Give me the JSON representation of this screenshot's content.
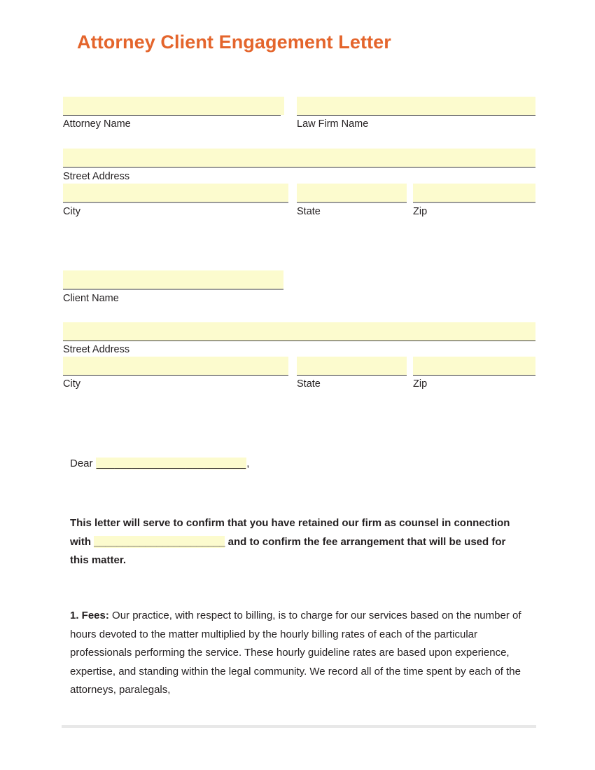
{
  "document": {
    "title": "Attorney Client Engagement Letter",
    "title_color": "#e4652c",
    "highlight_color": "#fcfbce",
    "page_background": "#ffffff",
    "text_color": "#231f20"
  },
  "attorney_block": {
    "name_field": {
      "caption": "Attorney Name",
      "value": ""
    },
    "firm_field": {
      "caption": "Law Firm Name",
      "value": ""
    },
    "street_field": {
      "caption": "Street Address",
      "value": ""
    },
    "city_field": {
      "caption": "City",
      "value": ""
    },
    "state_field": {
      "caption": "State",
      "value": ""
    },
    "zip_field": {
      "caption": "Zip",
      "value": ""
    }
  },
  "client_block": {
    "name_field": {
      "caption": "Client Name",
      "value": ""
    },
    "street_field": {
      "caption": "Street Address",
      "value": ""
    },
    "city_field": {
      "caption": "City",
      "value": ""
    },
    "state_field": {
      "caption": "State",
      "value": ""
    },
    "zip_field": {
      "caption": "Zip",
      "value": ""
    }
  },
  "salutation": {
    "prefix": "Dear ",
    "blank": "_________________________",
    "suffix": ","
  },
  "lead_paragraph": {
    "part1": "This letter will serve to confirm that you have retained our firm as counsel in connection with ",
    "blank": "_______________________",
    "part2": " and to confirm the fee arrangement that will be used for this matter."
  },
  "fees_section": {
    "label": "1. Fees:",
    "body": "  Our practice, with respect to billing, is to charge for our services based on the number of hours devoted to the matter multiplied by the hourly billing rates of each of the particular professionals performing the service. These hourly guideline rates are based upon experience, expertise, and standing within the legal community. We record all of the time spent by each of the attorneys, paralegals,"
  }
}
